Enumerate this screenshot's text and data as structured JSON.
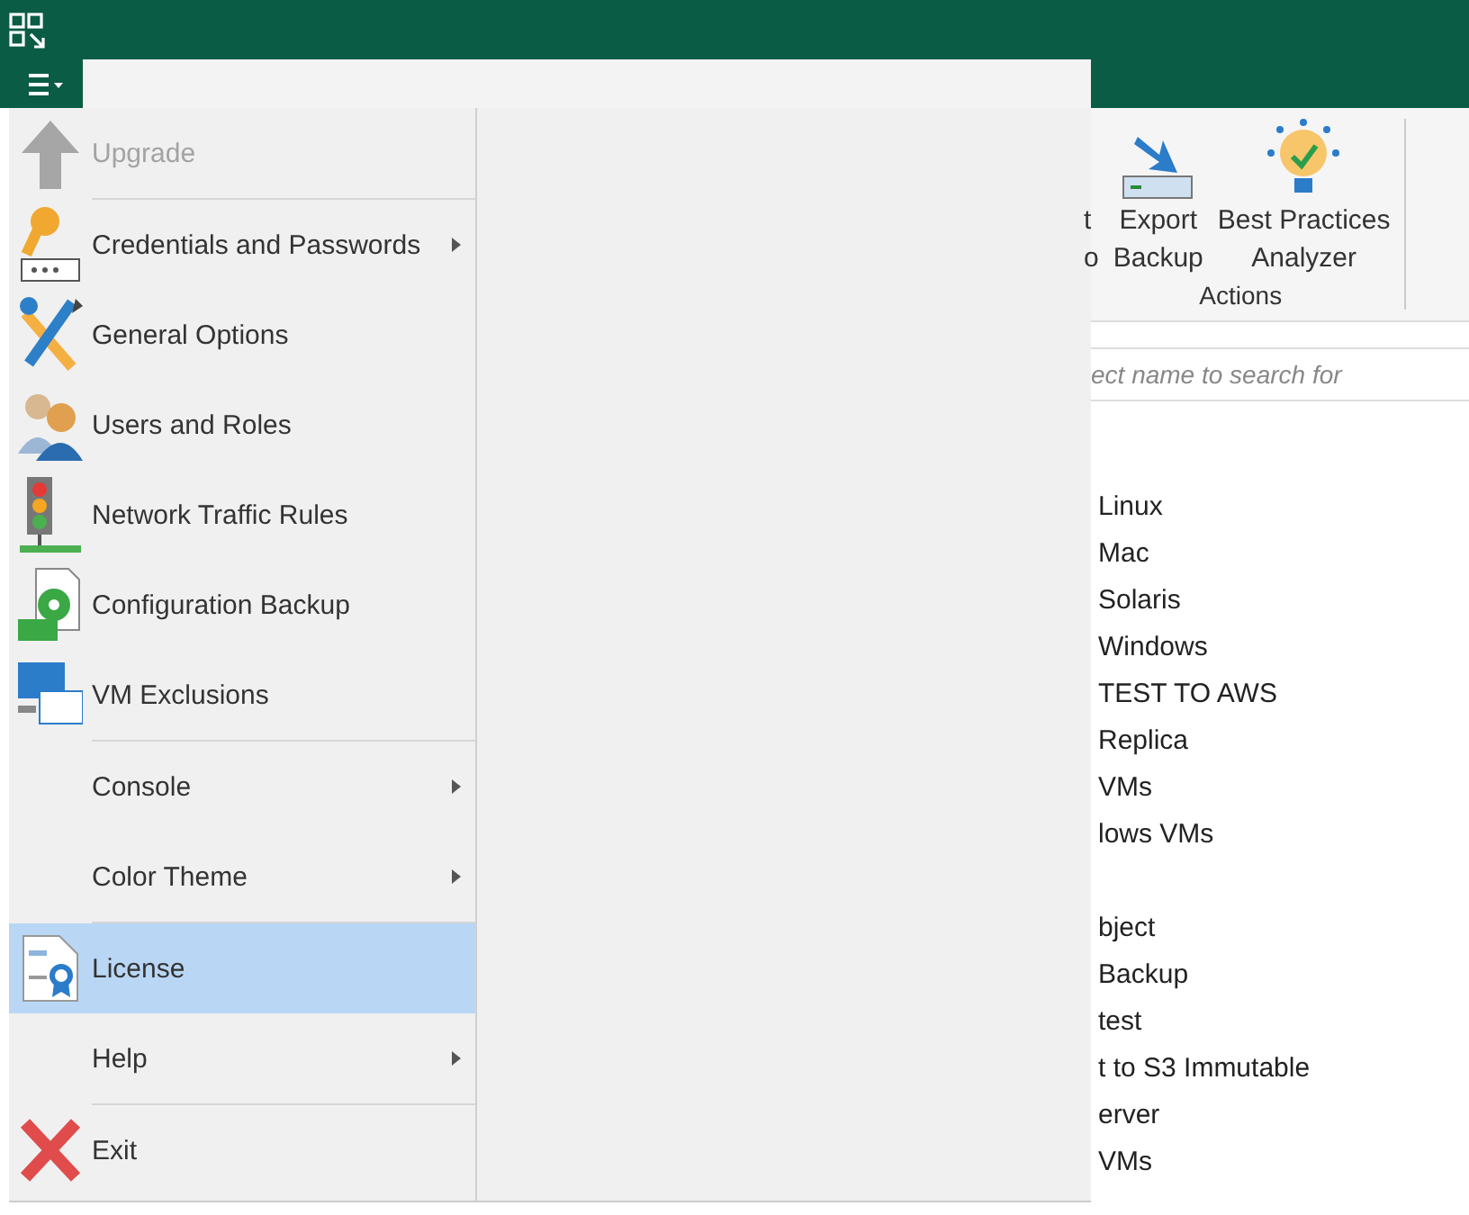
{
  "menu": {
    "groups": [
      [
        {
          "label": "Upgrade",
          "disabled": true,
          "submenu": false,
          "selected": false
        }
      ],
      [
        {
          "label": "Credentials and Passwords",
          "disabled": false,
          "submenu": true,
          "selected": false
        },
        {
          "label": "General Options",
          "disabled": false,
          "submenu": false,
          "selected": false
        },
        {
          "label": "Users and Roles",
          "disabled": false,
          "submenu": false,
          "selected": false
        },
        {
          "label": "Network Traffic Rules",
          "disabled": false,
          "submenu": false,
          "selected": false
        },
        {
          "label": "Configuration Backup",
          "disabled": false,
          "submenu": false,
          "selected": false
        },
        {
          "label": "VM Exclusions",
          "disabled": false,
          "submenu": false,
          "selected": false
        }
      ],
      [
        {
          "label": "Console",
          "disabled": false,
          "submenu": true,
          "selected": false
        },
        {
          "label": "Color Theme",
          "disabled": false,
          "submenu": true,
          "selected": false
        }
      ],
      [
        {
          "label": "License",
          "disabled": false,
          "submenu": false,
          "selected": true
        },
        {
          "label": "Help",
          "disabled": false,
          "submenu": true,
          "selected": false
        }
      ],
      [
        {
          "label": "Exit",
          "disabled": false,
          "submenu": false,
          "selected": false
        }
      ]
    ]
  },
  "ribbon": {
    "buttons": [
      {
        "lines": [
          "t",
          "o"
        ]
      },
      {
        "lines": [
          "Export",
          "Backup"
        ]
      },
      {
        "lines": [
          "Best Practices",
          "Analyzer"
        ]
      }
    ],
    "group_label": "Actions"
  },
  "search": {
    "placeholder": "ect name to search for"
  },
  "tree": {
    "groups": [
      [
        "Linux",
        "Mac",
        "Solaris",
        "Windows",
        "TEST TO AWS",
        "Replica",
        "VMs",
        "lows VMs"
      ],
      [
        "bject",
        "Backup",
        "test",
        "t to S3 Immutable",
        "erver",
        "VMs"
      ]
    ]
  }
}
